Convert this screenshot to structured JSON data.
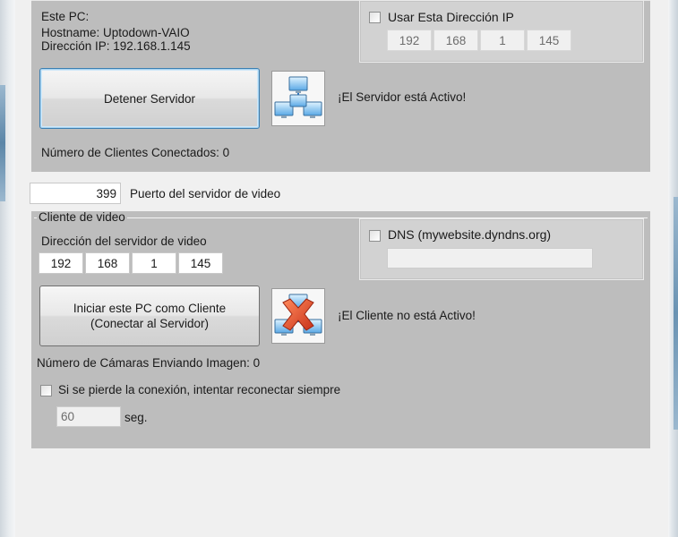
{
  "server_group": {
    "pc_label": "Este PC:",
    "hostname_line": "Hostname: Uptodown-VAIO",
    "ip_line": "Dirección IP: 192.168.1.145",
    "use_ip_label": "Usar Esta Dirección IP",
    "ip_octets": [
      "192",
      "168",
      "1",
      "145"
    ],
    "stop_button_label": "Detener Servidor",
    "status_text": "¡El Servidor está Activo!",
    "clients_connected_label": "Número de Clientes Conectados: 0"
  },
  "port": {
    "value": "399",
    "label": "Puerto del servidor de video"
  },
  "client_group": {
    "legend": "Cliente de video",
    "server_address_label": "Dirección del servidor de video",
    "ip_octets": [
      "192",
      "168",
      "1",
      "145"
    ],
    "dns_label": "DNS (mywebsite.dyndns.org)",
    "dns_value": "",
    "start_button_line1": "Iniciar este PC como Cliente",
    "start_button_line2": "(Conectar al Servidor)",
    "status_text": "¡El Cliente no está Activo!",
    "cameras_sending_label": "Número de Cámaras Enviando Imagen: 0",
    "reconnect_label": "Si se pierde la conexión, intentar reconectar siempre",
    "reconnect_seconds": "60",
    "seconds_unit": "seg."
  },
  "icons": {
    "server_status": "network-computers-icon",
    "client_status": "network-disconnected-icon"
  },
  "colors": {
    "group_background": "#bdbdbd",
    "window_background": "#f0f0f0",
    "error_x": "#e2461f"
  }
}
